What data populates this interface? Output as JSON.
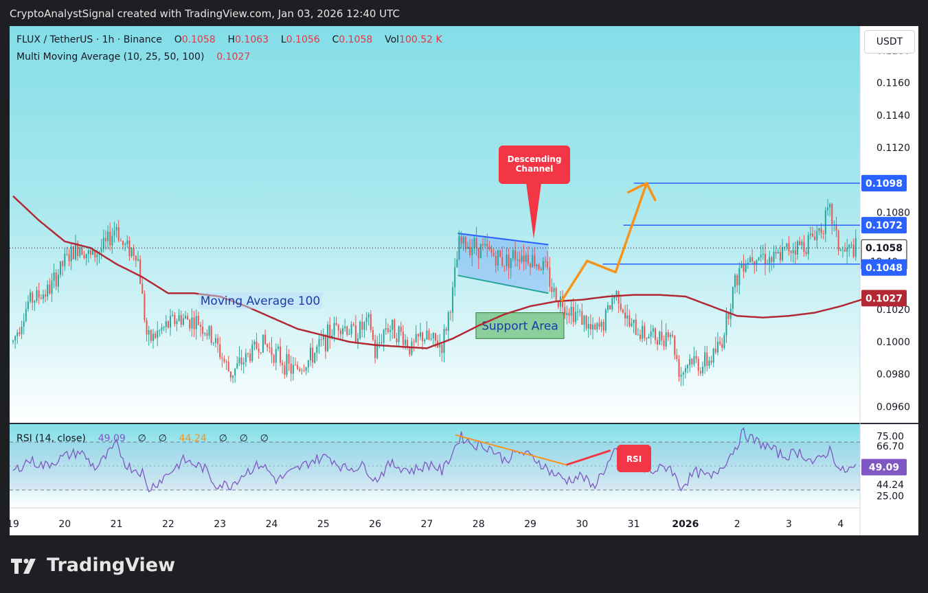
{
  "header": {
    "text": "CryptoAnalystSignal created with TradingView.com, Jan 03, 2026 12:40 UTC"
  },
  "legend": {
    "symbol": "FLUX / TetherUS · 1h · Binance",
    "o_label": "O",
    "o_value": "0.1058",
    "h_label": "H",
    "h_value": "0.1063",
    "l_label": "L",
    "l_value": "0.1056",
    "c_label": "C",
    "c_value": "0.1058",
    "vol_label": "Vol",
    "vol_value": "100.52 K",
    "mma_label": "Multi Moving Average (10, 25, 50, 100)",
    "mma_value": "0.1027"
  },
  "rsi_legend": {
    "label": "RSI (14, close)",
    "value": "49.09",
    "ph1": "∅",
    "ph2": "∅",
    "ma_value": "44.24",
    "ph3": "∅",
    "ph4": "∅",
    "ph5": "∅"
  },
  "unit": "USDT",
  "annotations": {
    "descending_channel": "Descending\nChannel",
    "ma100": "Moving Average 100",
    "support": "Support Area",
    "rsi": "RSI"
  },
  "price_labels": {
    "l1098": "0.1098",
    "l1072": "0.1072",
    "current": "0.1058",
    "countdown": "19:40",
    "l1048": "0.1048",
    "ma": "0.1027"
  },
  "rsi_labels": {
    "value": "49.09",
    "ma": "44.24"
  },
  "footer": {
    "brand": "TradingView"
  },
  "colors": {
    "bull": "#26a69a",
    "bear": "#ef5350",
    "ma": "#b22833",
    "level": "#2962ff",
    "arrow": "#f7931a",
    "rsi": "#7e57c2",
    "callout": "#f23645"
  },
  "chart_data": [
    {
      "type": "candlestick",
      "title": "FLUX / TetherUS · 1h · Binance",
      "ylim": [
        0.095,
        0.1195
      ],
      "yticks": [
        "0.1180",
        "0.1160",
        "0.1140",
        "0.1120",
        "0.1080",
        "0.1020",
        "0.1000",
        "0.0980",
        "0.0960"
      ],
      "xticks": [
        "19",
        "20",
        "21",
        "22",
        "23",
        "24",
        "25",
        "26",
        "27",
        "28",
        "29",
        "30",
        "31",
        "2026",
        "2",
        "3",
        "4"
      ],
      "ohlc_keypoints": [
        {
          "x": 19.0,
          "v": 0.1
        },
        {
          "x": 19.3,
          "v": 0.1025
        },
        {
          "x": 19.7,
          "v": 0.1032
        },
        {
          "x": 20.0,
          "v": 0.105
        },
        {
          "x": 20.3,
          "v": 0.106
        },
        {
          "x": 20.5,
          "v": 0.1052
        },
        {
          "x": 20.8,
          "v": 0.106
        },
        {
          "x": 21.0,
          "v": 0.1072
        },
        {
          "x": 21.1,
          "v": 0.106
        },
        {
          "x": 21.4,
          "v": 0.1055
        },
        {
          "x": 21.6,
          "v": 0.1
        },
        {
          "x": 21.9,
          "v": 0.1008
        },
        {
          "x": 22.2,
          "v": 0.1015
        },
        {
          "x": 22.6,
          "v": 0.1012
        },
        {
          "x": 22.9,
          "v": 0.1
        },
        {
          "x": 23.2,
          "v": 0.098
        },
        {
          "x": 23.5,
          "v": 0.099
        },
        {
          "x": 23.8,
          "v": 0.1
        },
        {
          "x": 24.1,
          "v": 0.0992
        },
        {
          "x": 24.4,
          "v": 0.0982
        },
        {
          "x": 24.7,
          "v": 0.0988
        },
        {
          "x": 25.0,
          "v": 0.1
        },
        {
          "x": 25.3,
          "v": 0.1012
        },
        {
          "x": 25.6,
          "v": 0.1005
        },
        {
          "x": 25.9,
          "v": 0.1012
        },
        {
          "x": 26.0,
          "v": 0.0992
        },
        {
          "x": 26.2,
          "v": 0.101
        },
        {
          "x": 26.5,
          "v": 0.1005
        },
        {
          "x": 26.7,
          "v": 0.0995
        },
        {
          "x": 26.9,
          "v": 0.1004
        },
        {
          "x": 27.1,
          "v": 0.1
        },
        {
          "x": 27.3,
          "v": 0.0998
        },
        {
          "x": 27.5,
          "v": 0.103
        },
        {
          "x": 27.62,
          "v": 0.106
        },
        {
          "x": 27.9,
          "v": 0.106
        },
        {
          "x": 28.2,
          "v": 0.1055
        },
        {
          "x": 28.5,
          "v": 0.105
        },
        {
          "x": 28.8,
          "v": 0.1055
        },
        {
          "x": 29.0,
          "v": 0.1052
        },
        {
          "x": 29.3,
          "v": 0.1045
        },
        {
          "x": 29.45,
          "v": 0.103
        },
        {
          "x": 29.7,
          "v": 0.1022
        },
        {
          "x": 30.0,
          "v": 0.1015
        },
        {
          "x": 30.2,
          "v": 0.1005
        },
        {
          "x": 30.4,
          "v": 0.101
        },
        {
          "x": 30.6,
          "v": 0.1028
        },
        {
          "x": 30.7,
          "v": 0.103
        },
        {
          "x": 30.9,
          "v": 0.101
        },
        {
          "x": 31.2,
          "v": 0.1005
        },
        {
          "x": 31.5,
          "v": 0.1002
        },
        {
          "x": 31.7,
          "v": 0.1008
        },
        {
          "x": 31.9,
          "v": 0.098
        },
        {
          "x": 32.1,
          "v": 0.099
        },
        {
          "x": 32.3,
          "v": 0.0985
        },
        {
          "x": 32.5,
          "v": 0.099
        },
        {
          "x": 32.7,
          "v": 0.1
        },
        {
          "x": 32.9,
          "v": 0.103
        },
        {
          "x": 33.1,
          "v": 0.105
        },
        {
          "x": 33.4,
          "v": 0.1055
        },
        {
          "x": 33.7,
          "v": 0.105
        },
        {
          "x": 34.0,
          "v": 0.1058
        },
        {
          "x": 34.3,
          "v": 0.106
        },
        {
          "x": 34.6,
          "v": 0.107
        },
        {
          "x": 34.8,
          "v": 0.108
        },
        {
          "x": 34.95,
          "v": 0.106
        },
        {
          "x": 35.05,
          "v": 0.1055
        },
        {
          "x": 35.3,
          "v": 0.1058
        }
      ],
      "ma100": [
        {
          "x": 19.0,
          "v": 0.109
        },
        {
          "x": 19.5,
          "v": 0.1075
        },
        {
          "x": 20.0,
          "v": 0.1062
        },
        {
          "x": 20.5,
          "v": 0.1058
        },
        {
          "x": 21.0,
          "v": 0.1048
        },
        {
          "x": 21.5,
          "v": 0.104
        },
        {
          "x": 22.0,
          "v": 0.103
        },
        {
          "x": 22.5,
          "v": 0.103
        },
        {
          "x": 23.0,
          "v": 0.1028
        },
        {
          "x": 23.5,
          "v": 0.1022
        },
        {
          "x": 24.0,
          "v": 0.1015
        },
        {
          "x": 24.5,
          "v": 0.1008
        },
        {
          "x": 25.0,
          "v": 0.1004
        },
        {
          "x": 25.5,
          "v": 0.1
        },
        {
          "x": 26.0,
          "v": 0.0998
        },
        {
          "x": 26.5,
          "v": 0.0997
        },
        {
          "x": 27.0,
          "v": 0.0996
        },
        {
          "x": 27.5,
          "v": 0.1002
        },
        {
          "x": 28.0,
          "v": 0.101
        },
        {
          "x": 28.5,
          "v": 0.1017
        },
        {
          "x": 29.0,
          "v": 0.1022
        },
        {
          "x": 29.5,
          "v": 0.1025
        },
        {
          "x": 30.0,
          "v": 0.1026
        },
        {
          "x": 30.5,
          "v": 0.1028
        },
        {
          "x": 31.0,
          "v": 0.1029
        },
        {
          "x": 31.5,
          "v": 0.1029
        },
        {
          "x": 32.0,
          "v": 0.1028
        },
        {
          "x": 32.5,
          "v": 0.1022
        },
        {
          "x": 33.0,
          "v": 0.1016
        },
        {
          "x": 33.5,
          "v": 0.1015
        },
        {
          "x": 34.0,
          "v": 0.1016
        },
        {
          "x": 34.5,
          "v": 0.1018
        },
        {
          "x": 35.0,
          "v": 0.1022
        },
        {
          "x": 35.5,
          "v": 0.1027
        }
      ],
      "levels": [
        {
          "price": 0.1098,
          "x_from": 31.0
        },
        {
          "price": 0.1072,
          "x_from": 30.8
        },
        {
          "price": 0.1048,
          "x_from": 30.4
        }
      ],
      "current_price": 0.1058,
      "descending_channel": {
        "upper": [
          {
            "x": 27.6,
            "v": 0.1067
          },
          {
            "x": 29.35,
            "v": 0.106
          }
        ],
        "lower": [
          {
            "x": 27.6,
            "v": 0.1041
          },
          {
            "x": 29.35,
            "v": 0.103
          }
        ]
      },
      "support_area": {
        "x_from": 27.95,
        "x_to": 29.65,
        "v_from": 0.1002,
        "v_to": 0.1018
      },
      "projection_path": [
        {
          "x": 29.6,
          "v": 0.1025
        },
        {
          "x": 30.1,
          "v": 0.105
        },
        {
          "x": 30.65,
          "v": 0.1043
        },
        {
          "x": 31.25,
          "v": 0.1098
        }
      ]
    },
    {
      "type": "line",
      "title": "RSI (14, close)",
      "ylim": [
        15,
        85
      ],
      "yticks": [
        "75.00",
        "66.70",
        "25.00"
      ],
      "bands": [
        70,
        30
      ],
      "rsi_keypoints": [
        {
          "x": 19.0,
          "v": 45
        },
        {
          "x": 19.3,
          "v": 55
        },
        {
          "x": 19.6,
          "v": 50
        },
        {
          "x": 20.0,
          "v": 58
        },
        {
          "x": 20.3,
          "v": 62
        },
        {
          "x": 20.6,
          "v": 48
        },
        {
          "x": 20.9,
          "v": 63
        },
        {
          "x": 21.0,
          "v": 68
        },
        {
          "x": 21.2,
          "v": 50
        },
        {
          "x": 21.5,
          "v": 45
        },
        {
          "x": 21.6,
          "v": 30
        },
        {
          "x": 21.9,
          "v": 40
        },
        {
          "x": 22.3,
          "v": 55
        },
        {
          "x": 22.7,
          "v": 48
        },
        {
          "x": 22.9,
          "v": 35
        },
        {
          "x": 23.2,
          "v": 34
        },
        {
          "x": 23.5,
          "v": 45
        },
        {
          "x": 23.8,
          "v": 52
        },
        {
          "x": 24.1,
          "v": 38
        },
        {
          "x": 24.4,
          "v": 45
        },
        {
          "x": 24.8,
          "v": 55
        },
        {
          "x": 25.1,
          "v": 58
        },
        {
          "x": 25.4,
          "v": 48
        },
        {
          "x": 25.8,
          "v": 50
        },
        {
          "x": 26.0,
          "v": 38
        },
        {
          "x": 26.3,
          "v": 52
        },
        {
          "x": 26.7,
          "v": 46
        },
        {
          "x": 27.1,
          "v": 52
        },
        {
          "x": 27.3,
          "v": 45
        },
        {
          "x": 27.5,
          "v": 62
        },
        {
          "x": 27.65,
          "v": 75
        },
        {
          "x": 27.9,
          "v": 68
        },
        {
          "x": 28.2,
          "v": 66
        },
        {
          "x": 28.5,
          "v": 55
        },
        {
          "x": 28.8,
          "v": 62
        },
        {
          "x": 29.1,
          "v": 56
        },
        {
          "x": 29.4,
          "v": 45
        },
        {
          "x": 29.7,
          "v": 38
        },
        {
          "x": 30.0,
          "v": 42
        },
        {
          "x": 30.2,
          "v": 32
        },
        {
          "x": 30.4,
          "v": 45
        },
        {
          "x": 30.65,
          "v": 62
        },
        {
          "x": 30.9,
          "v": 50
        },
        {
          "x": 31.3,
          "v": 45
        },
        {
          "x": 31.7,
          "v": 50
        },
        {
          "x": 31.9,
          "v": 32
        },
        {
          "x": 32.2,
          "v": 45
        },
        {
          "x": 32.5,
          "v": 40
        },
        {
          "x": 32.8,
          "v": 55
        },
        {
          "x": 33.0,
          "v": 68
        },
        {
          "x": 33.1,
          "v": 78
        },
        {
          "x": 33.3,
          "v": 72
        },
        {
          "x": 33.6,
          "v": 66
        },
        {
          "x": 33.9,
          "v": 58
        },
        {
          "x": 34.2,
          "v": 62
        },
        {
          "x": 34.5,
          "v": 52
        },
        {
          "x": 34.8,
          "v": 64
        },
        {
          "x": 35.0,
          "v": 45
        },
        {
          "x": 35.3,
          "v": 49
        }
      ],
      "divergence_line": [
        {
          "x": 27.55,
          "v": 76
        },
        {
          "x": 29.7,
          "v": 51
        }
      ],
      "trend_line": [
        {
          "x": 29.7,
          "v": 51
        },
        {
          "x": 30.55,
          "v": 63
        }
      ]
    }
  ]
}
